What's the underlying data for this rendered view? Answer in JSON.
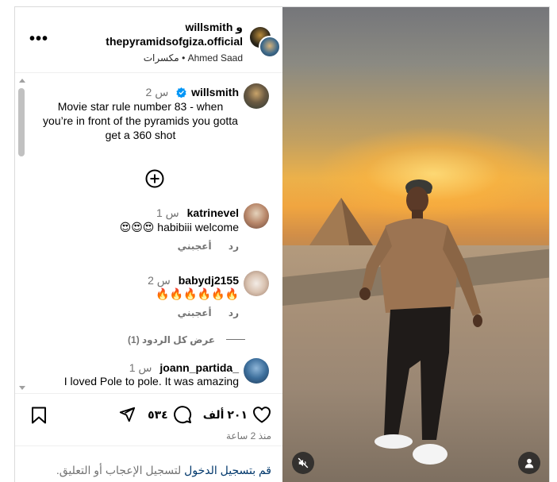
{
  "header": {
    "user1": "willsmith",
    "and_word": "و",
    "user2": "thepyramidsofgiza.official",
    "audio_artist": "Ahmed Saad",
    "audio_separator": "•",
    "audio_title": "مكسرات"
  },
  "caption": {
    "username": "willsmith",
    "time": "2 س",
    "text": "Movie star rule number 83 - when you’re in front of the pyramids you gotta get a 360 shot"
  },
  "comments": [
    {
      "username": "katrinevel",
      "time": "1 س",
      "text": "habibiii welcome",
      "emojis": "😍😍😍",
      "like_label": "أعجبني",
      "reply_label": "رد"
    },
    {
      "username": "babydj2155",
      "time": "2 س",
      "emojis": "🔥🔥🔥🔥🔥🔥",
      "like_label": "أعجبني",
      "reply_label": "رد"
    },
    {
      "username": "joann_partida_",
      "time": "1 س",
      "text": "I loved Pole to pole. It was amazing"
    }
  ],
  "view_replies": "عرض كل الردود (1)",
  "actions": {
    "likes": "٢٠١ ألف",
    "comments": "٥٣٤",
    "since": "منذ 2 ساعة"
  },
  "login": {
    "link": "قم بتسجيل الدخول",
    "rest": "لتسجيل الإعجاب أو التعليق."
  },
  "icons": {
    "more": "more-icon",
    "heart": "heart-icon",
    "comment": "comment-icon",
    "share": "share-icon",
    "bookmark": "bookmark-icon",
    "mute": "mute-icon",
    "tagged_user": "user-icon",
    "add": "plus-circle-icon"
  },
  "colors": {
    "verified": "#0095f6",
    "link": "#00376b",
    "muted_text": "#737373",
    "border": "#dbdbdb"
  }
}
